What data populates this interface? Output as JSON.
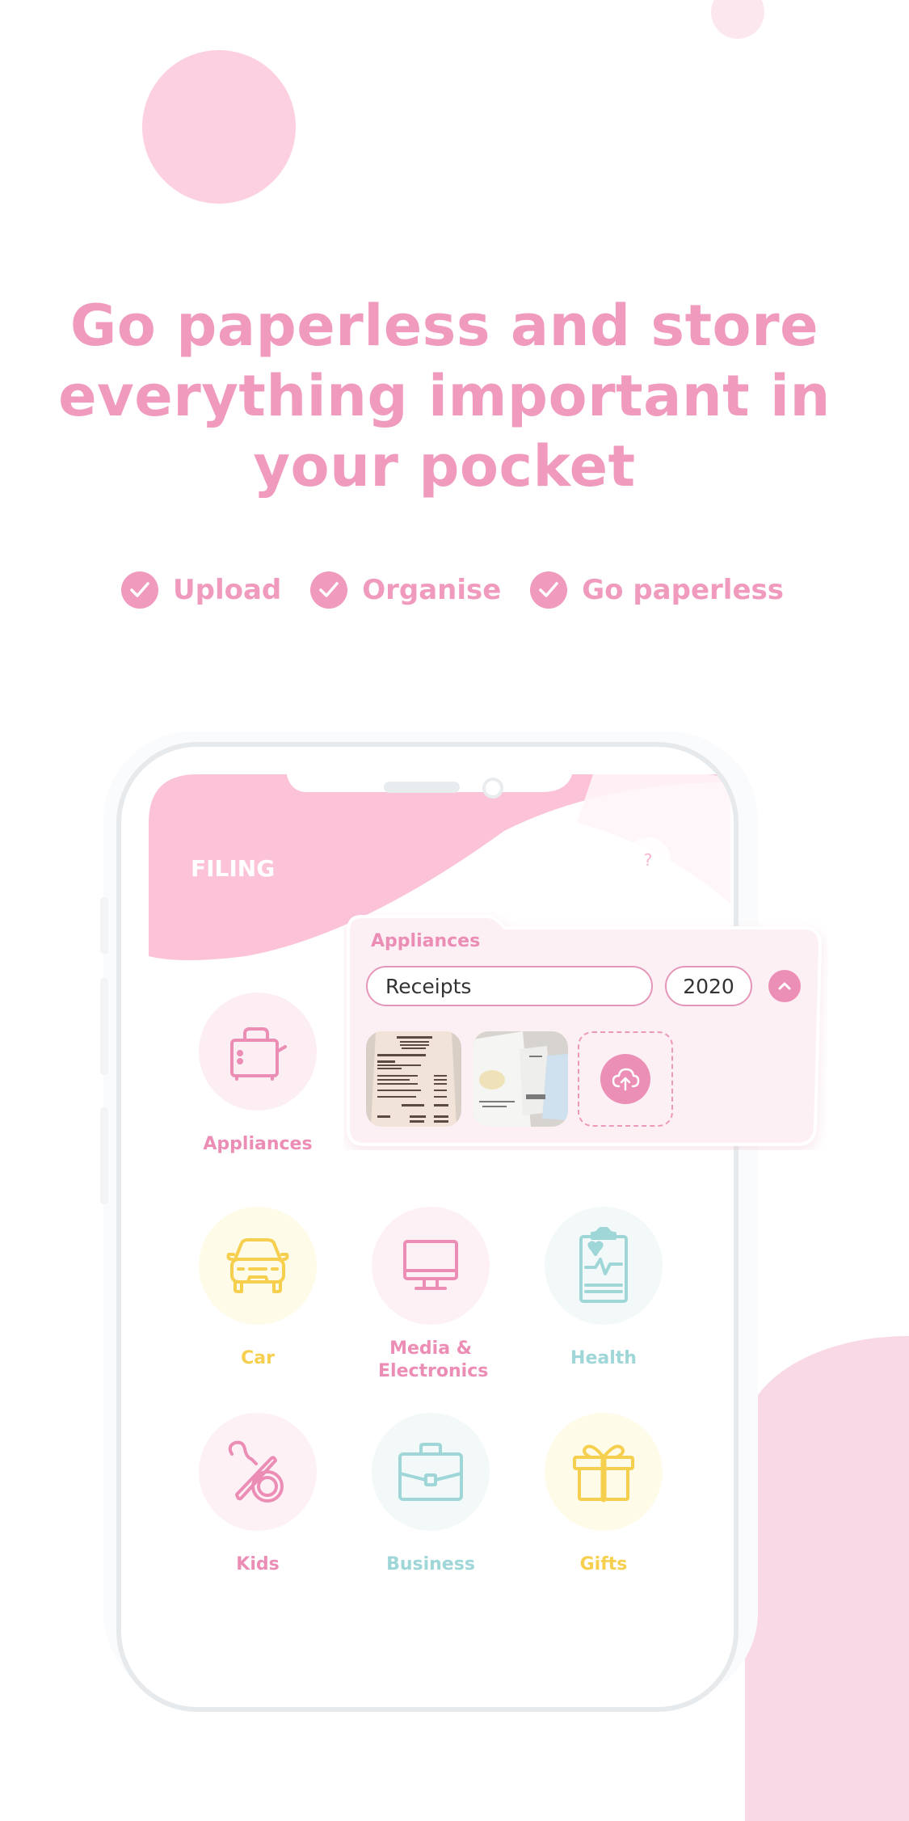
{
  "headline": {
    "line1": "Go paperless and store",
    "line2": "everything important in",
    "line3": "your pocket"
  },
  "features": [
    {
      "icon": "check-circle-icon",
      "label": "Upload"
    },
    {
      "icon": "check-circle-icon",
      "label": "Organise"
    },
    {
      "icon": "check-circle-icon",
      "label": "Go paperless"
    }
  ],
  "phone": {
    "header": {
      "title": "FILING",
      "help_label": "?"
    },
    "popup": {
      "title": "Appliances",
      "folder_value": "Receipts",
      "year_value": "2020",
      "collapse_icon": "chevron-up-icon",
      "thumbnails": [
        {
          "alt": "receipt-photo-1"
        },
        {
          "alt": "receipt-photo-2"
        }
      ],
      "upload_icon": "cloud-upload-icon"
    },
    "categories": [
      {
        "label": "Appliances",
        "icon": "toaster-icon",
        "color": "#eb8db5",
        "bg": "#fdeef4"
      },
      {
        "label": "Car",
        "icon": "car-icon",
        "color": "#f6cf4f",
        "bg": "#fefbe8"
      },
      {
        "label": "Media & Electronics",
        "icon": "monitor-icon",
        "color": "#eb8db5",
        "bg": "#fdf1f5"
      },
      {
        "label": "Health",
        "icon": "clipboard-heart-icon",
        "color": "#9fd6d8",
        "bg": "#f3f9f9"
      },
      {
        "label": "Kids",
        "icon": "pacifier-icon",
        "color": "#eb8db5",
        "bg": "#fdf1f5"
      },
      {
        "label": "Business",
        "icon": "briefcase-icon",
        "color": "#9fd6d8",
        "bg": "#f3f9f9"
      },
      {
        "label": "Gifts",
        "icon": "gift-icon",
        "color": "#f6cf4f",
        "bg": "#fefbe8"
      }
    ]
  },
  "colors": {
    "brand_pink": "#f09abd",
    "header_pink": "#fbc2d8",
    "yellow": "#f6cf4f",
    "teal": "#9fd6d8"
  }
}
